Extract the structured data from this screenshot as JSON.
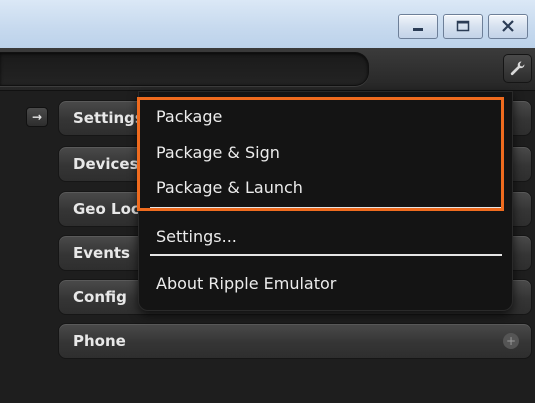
{
  "window": {
    "controls": [
      {
        "name": "minimize",
        "icon": "minimize-icon"
      },
      {
        "name": "maximize",
        "icon": "maximize-icon"
      },
      {
        "name": "close",
        "icon": "close-icon"
      }
    ]
  },
  "toolbar": {
    "address_value": "",
    "settings_icon": "wrench-icon"
  },
  "panel": {
    "toggle_icon": "arrow-right-icon",
    "toggle_glyph": "→",
    "sections": [
      {
        "label": "Settings",
        "icon": ""
      },
      {
        "label": "Devices",
        "icon": ""
      },
      {
        "label": "Geo Location",
        "icon": ""
      },
      {
        "label": "Events",
        "icon": ""
      },
      {
        "label": "Config",
        "icon": ""
      },
      {
        "label": "Phone",
        "icon": "plus-icon",
        "icon_glyph": "+"
      }
    ]
  },
  "menu": {
    "items": [
      {
        "label": "Package"
      },
      {
        "label": "Package & Sign"
      },
      {
        "label": "Package & Launch"
      },
      {
        "label": "Settings..."
      },
      {
        "label": "About Ripple Emulator"
      }
    ]
  },
  "colors": {
    "highlight": "#ef6b1e",
    "menu_background": "#141414",
    "panel_background": "#1e1e1e"
  }
}
